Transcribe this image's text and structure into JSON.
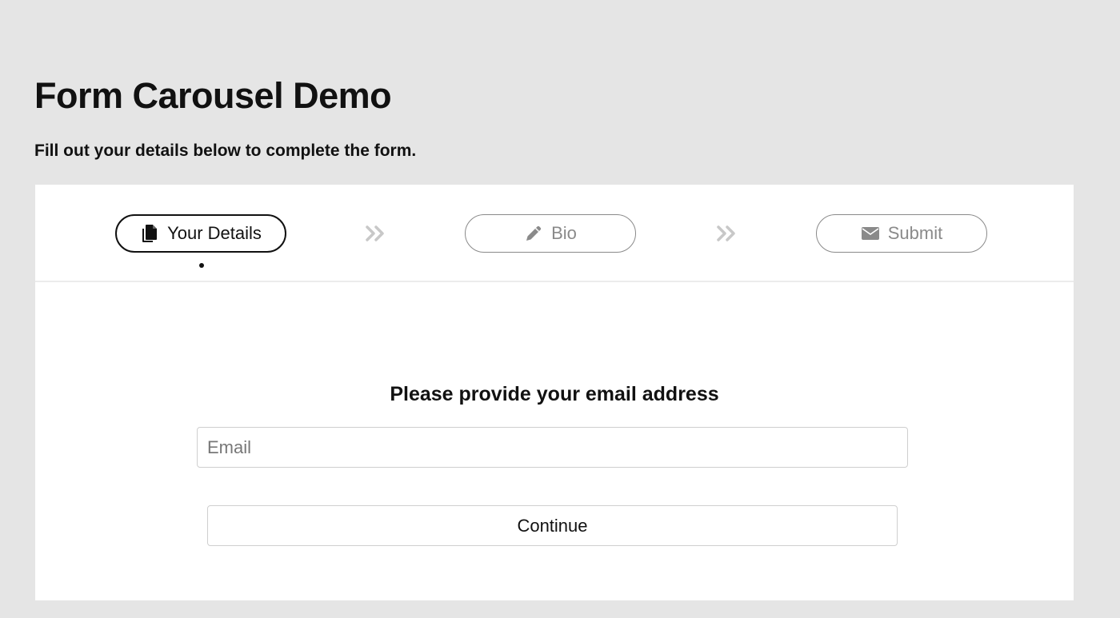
{
  "header": {
    "title": "Form Carousel Demo",
    "subtitle": "Fill out your details below to complete the form."
  },
  "steps": [
    {
      "label": "Your Details",
      "icon": "documents-icon",
      "state": "active"
    },
    {
      "label": "Bio",
      "icon": "pencil-icon",
      "state": "inactive"
    },
    {
      "label": "Submit",
      "icon": "envelope-icon",
      "state": "inactive"
    }
  ],
  "form": {
    "title": "Please provide your email address",
    "email_placeholder": "Email",
    "email_value": "",
    "continue_label": "Continue"
  },
  "colors": {
    "page_background": "#e5e5e5",
    "card_background": "#ffffff",
    "active": "#111111",
    "inactive": "#8a8a8a",
    "chevron": "#c8c8c8"
  }
}
